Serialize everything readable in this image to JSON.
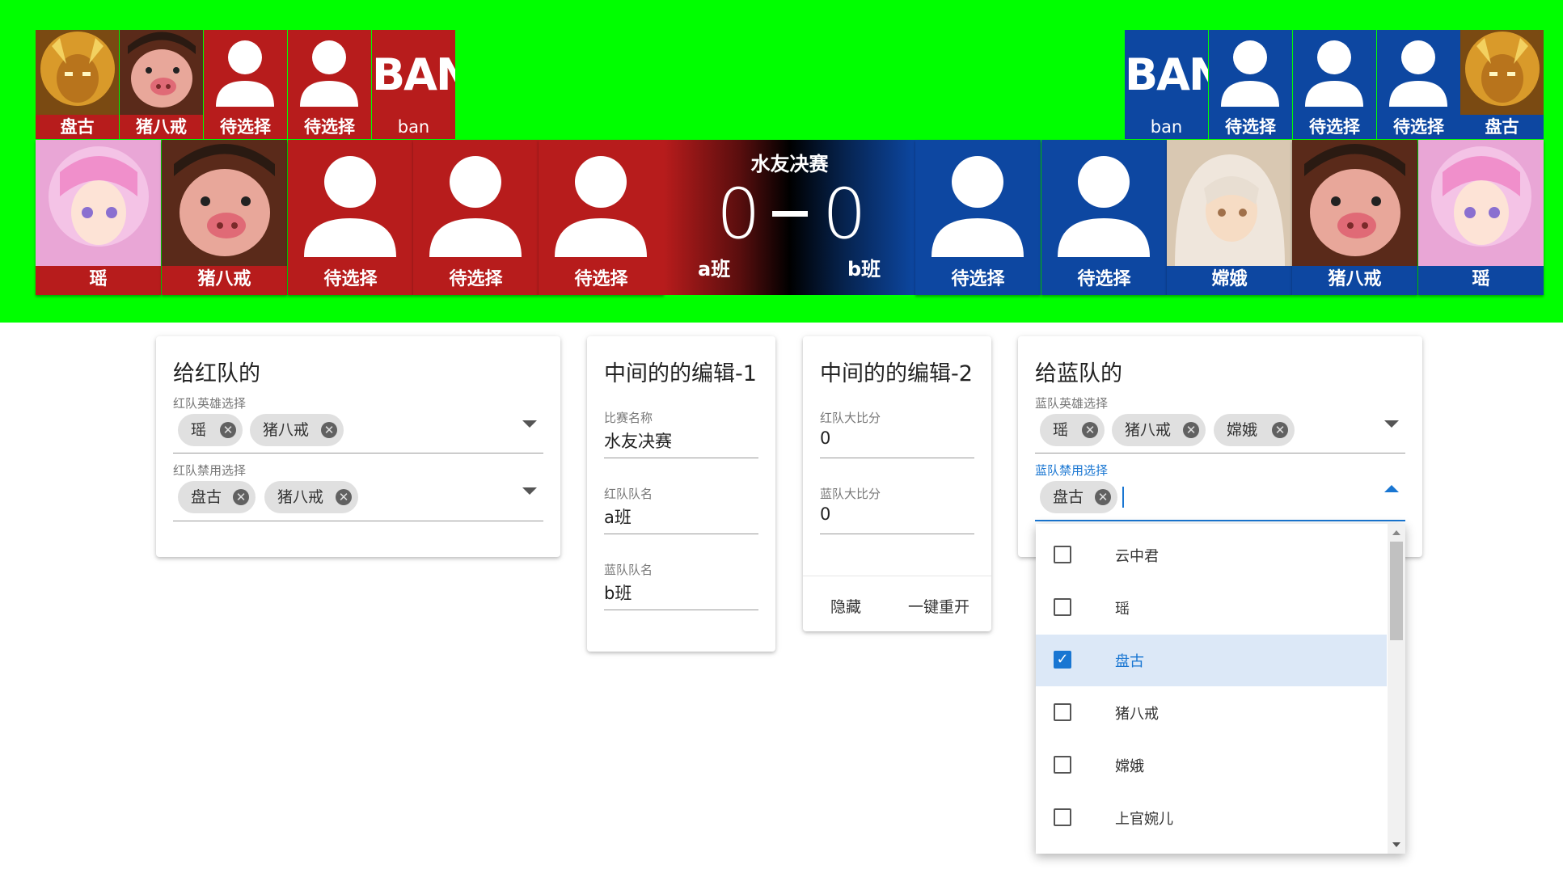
{
  "colors": {
    "green_screen": "#00ff00",
    "red_team": "#b71c1c",
    "blue_team": "#0d47a1",
    "accent": "#1976d2"
  },
  "overlay": {
    "match_title": "水友决赛",
    "red_score": "0",
    "blue_score": "0",
    "red_team_name": "a班",
    "blue_team_name": "b班",
    "ban_word": "BAN",
    "red_bans": [
      "盘古",
      "猪八戒",
      "待选择",
      "待选择",
      "ban"
    ],
    "blue_bans": [
      "ban",
      "待选择",
      "待选择",
      "待选择",
      "盘古"
    ],
    "red_picks": [
      "瑶",
      "猪八戒",
      "待选择",
      "待选择",
      "待选择"
    ],
    "blue_picks": [
      "待选择",
      "待选择",
      "嫦娥",
      "猪八戒",
      "瑶"
    ]
  },
  "red_card": {
    "title": "给红队的",
    "hero_label": "红队英雄选择",
    "hero_chips": [
      "瑶",
      "猪八戒"
    ],
    "ban_label": "红队禁用选择",
    "ban_chips": [
      "盘古",
      "猪八戒"
    ]
  },
  "middle1": {
    "title": "中间的的编辑-1",
    "match_name_label": "比赛名称",
    "match_name": "水友决赛",
    "red_name_label": "红队队名",
    "red_name": "a班",
    "blue_name_label": "蓝队队名",
    "blue_name": "b班"
  },
  "middle2": {
    "title": "中间的的编辑-2",
    "red_score_label": "红队大比分",
    "red_score": "0",
    "blue_score_label": "蓝队大比分",
    "blue_score": "0",
    "hide_label": "隐藏",
    "reset_label": "一键重开"
  },
  "blue_card": {
    "title": "给蓝队的",
    "hero_label": "蓝队英雄选择",
    "hero_chips": [
      "瑶",
      "猪八戒",
      "嫦娥"
    ],
    "ban_label": "蓝队禁用选择",
    "ban_chips": [
      "盘古"
    ]
  },
  "dropdown": {
    "options": [
      {
        "label": "云中君",
        "checked": false
      },
      {
        "label": "瑶",
        "checked": false
      },
      {
        "label": "盘古",
        "checked": true
      },
      {
        "label": "猪八戒",
        "checked": false
      },
      {
        "label": "嫦娥",
        "checked": false
      },
      {
        "label": "上官婉儿",
        "checked": false
      }
    ]
  },
  "icons": {
    "chip_delete": "cancel-icon",
    "check": "check-icon",
    "placeholder_avatar": "person-icon"
  }
}
